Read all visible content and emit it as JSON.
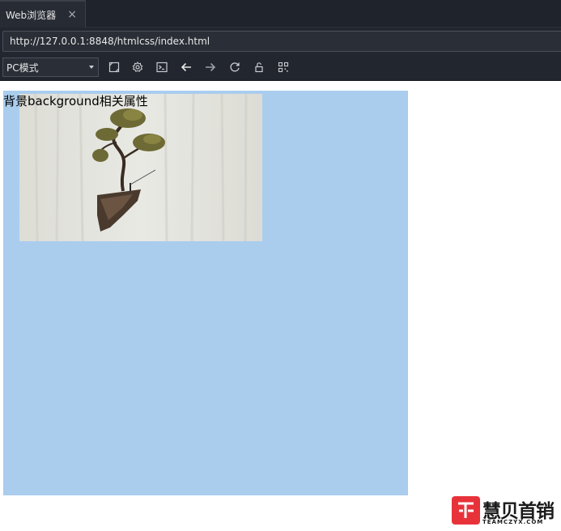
{
  "tab": {
    "title": "Web浏览器",
    "close_symbol": "×"
  },
  "address_bar": {
    "url": "http://127.0.0.1:8848/htmlcss/index.html"
  },
  "toolbar": {
    "mode_selected": "PC模式",
    "icons": [
      "responsive-icon",
      "settings-icon",
      "console-icon",
      "back-arrow-icon",
      "forward-arrow-icon",
      "reload-icon",
      "unlock-icon",
      "qrcode-icon"
    ]
  },
  "page": {
    "heading": "背景background相关属性",
    "box_color": "#aacdee"
  },
  "watermark": {
    "brand": "慧贝首销",
    "domain": "TEAMCZYX.COM"
  }
}
